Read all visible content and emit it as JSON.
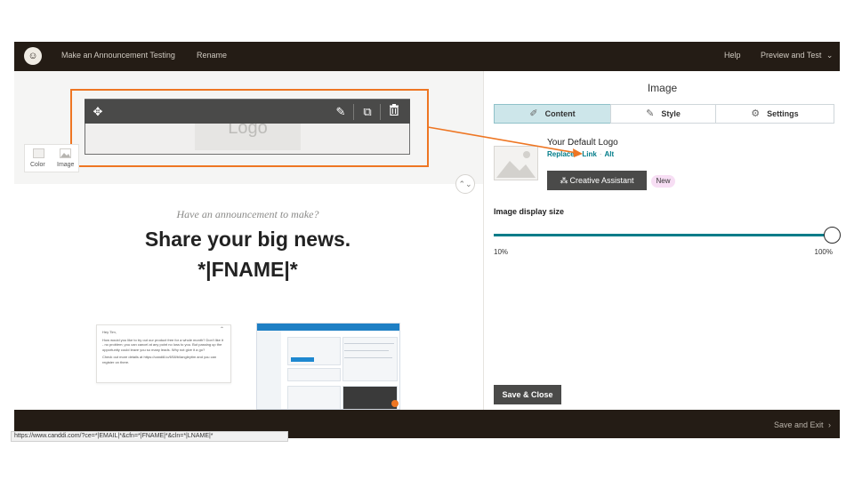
{
  "topbar": {
    "campaign_name": "Make an Announcement Testing",
    "rename": "Rename",
    "help": "Help",
    "preview_test": "Preview and Test",
    "preview_chevron": "⌄"
  },
  "editor": {
    "logo_placeholder": "Logo",
    "side_chips": {
      "color": "Color",
      "image": "Image"
    },
    "kicker": "Have an announcement to make?",
    "headline": "Share your big news.",
    "merge_tag": "*|FNAME|*",
    "email_card_text": [
      "Hey Tim,",
      "How would you like to try out our product free for a whole month? Don't like it - no problem; you can cancel at any point no loss to you. But passing up the opportunity could leave you so many leads. Why not give it a go?",
      "Check out more details at https://candi8.io/6S8/b/langleytim and you can register on there."
    ]
  },
  "panel": {
    "title": "Image",
    "tabs": [
      {
        "label": "Content",
        "icon": "pencil-icon",
        "active": true
      },
      {
        "label": "Style",
        "icon": "paintbrush-icon",
        "active": false
      },
      {
        "label": "Settings",
        "icon": "gear-icon",
        "active": false
      }
    ],
    "logo_name": "Your Default Logo",
    "links": [
      "Replace",
      "Link",
      "Alt"
    ],
    "creative_assistant": "Creative Assistant",
    "new_badge": "New",
    "display_size_label": "Image display size",
    "slider": {
      "min_label": "10%",
      "max_label": "100%",
      "value": 1.0
    },
    "save_close": "Save & Close"
  },
  "footer": {
    "save_exit": "Save and Exit",
    "status_url": "https://www.canddi.com/?ce=*|EMAIL|*&cfn=*|FNAME|*&cln=*|LNAME|*"
  },
  "colors": {
    "chrome_dark": "#241c15",
    "accent_teal": "#007c89",
    "annotation_orange": "#ee7623",
    "tab_active_bg": "#cde6ea",
    "button_dark": "#4a4a49"
  }
}
